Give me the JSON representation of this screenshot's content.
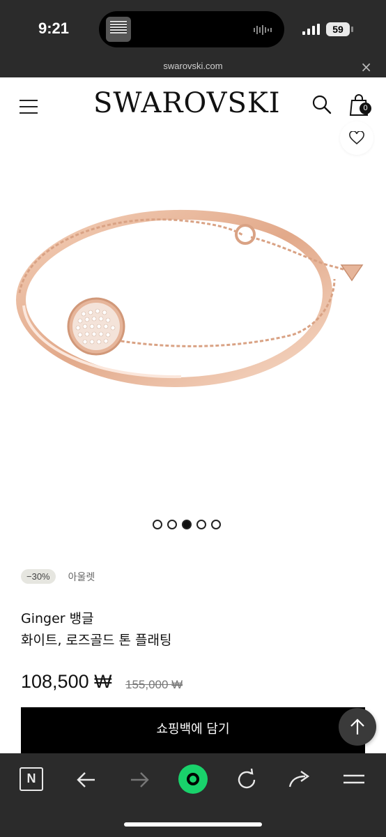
{
  "status_bar": {
    "time": "9:21",
    "battery": "59"
  },
  "browser": {
    "url": "swarovski.com",
    "close_glyph": "×"
  },
  "header": {
    "logo": "SWAROVSKI",
    "bag_count": "0",
    "icons": [
      "menu-icon",
      "search-icon",
      "bag-icon",
      "heart-icon"
    ]
  },
  "gallery": {
    "total": 5,
    "active_index": 2
  },
  "product": {
    "discount_badge": "−30%",
    "outlet_label": "아울렛",
    "name_line1": "Ginger 뱅글",
    "name_line2": "화이트, 로즈골드 톤 플래팅",
    "price": "108,500 ₩",
    "old_price": "155,000 ₩"
  },
  "cart_button": {
    "label": "쇼핑백에 담기"
  },
  "bottom_nav": {
    "n_label": "N",
    "icons": [
      "n-tab-icon",
      "back-arrow-icon",
      "forward-arrow-icon",
      "home-circle-icon",
      "refresh-icon",
      "share-icon",
      "menu-lines-icon"
    ]
  },
  "colors": {
    "rose_gold": "#e7b79c",
    "accent_green": "#19d26b",
    "dark_bar": "#2b2b2b"
  }
}
